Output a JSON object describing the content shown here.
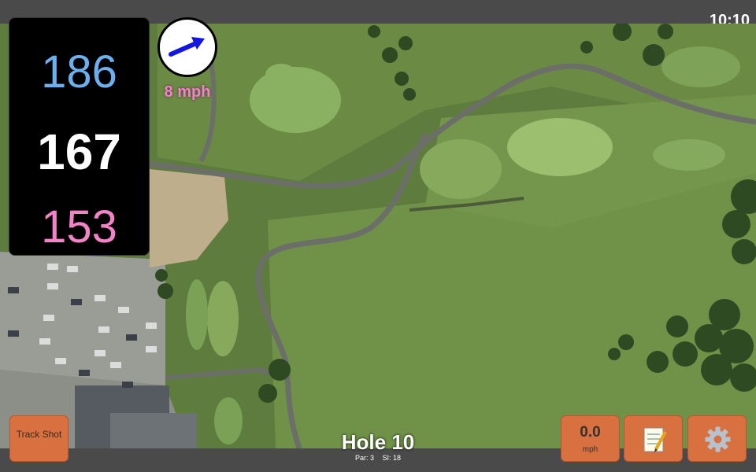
{
  "status": {
    "time": "10:10"
  },
  "distances": {
    "back": "186",
    "middle": "167",
    "front": "153"
  },
  "wind": {
    "speed_label": "8 mph",
    "direction_icon": "arrow-icon"
  },
  "buttons": {
    "track_shot": "Track Shot",
    "speed_value": "0.0",
    "speed_unit": "mph",
    "notes_icon": "notepad-icon",
    "settings_icon": "gear-icon"
  },
  "hole": {
    "title": "Hole 10",
    "par": "Par: 3",
    "si": "SI: 18"
  },
  "colors": {
    "back": "#6cb0f0",
    "middle": "#ffffff",
    "front": "#f283c6",
    "button": "#d9703f",
    "bar": "#4a4a4a"
  }
}
